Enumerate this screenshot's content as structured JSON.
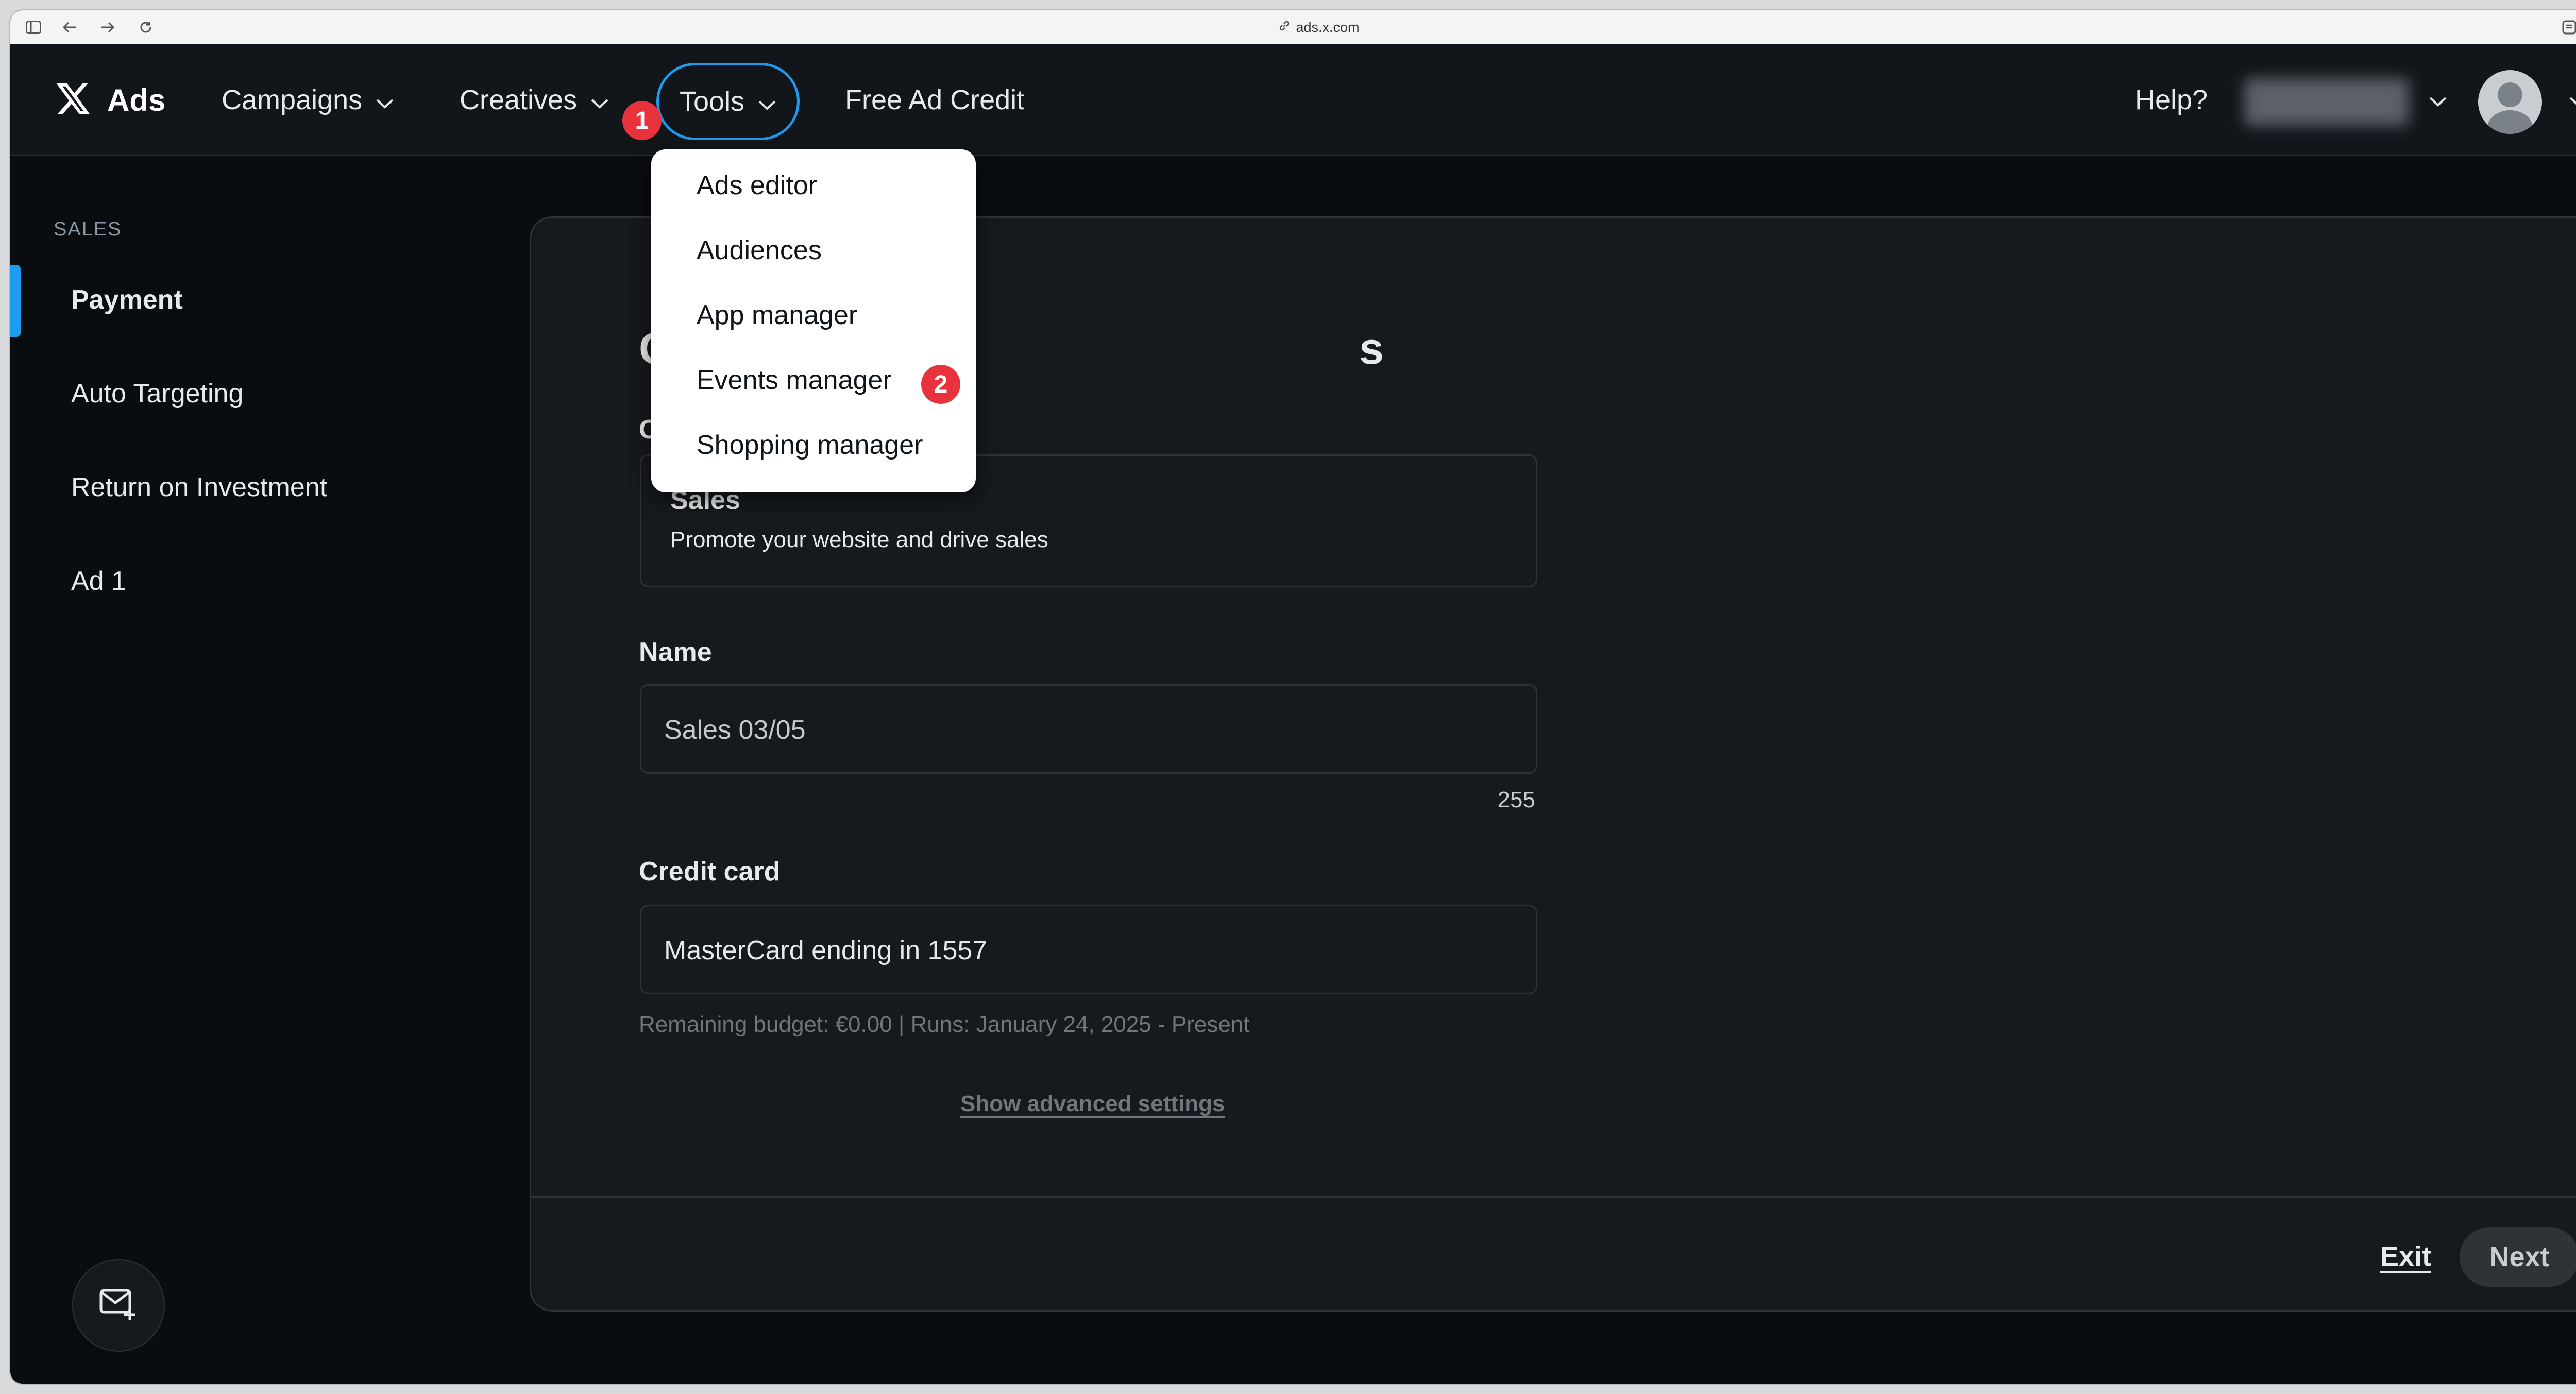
{
  "browser": {
    "url": "ads.x.com"
  },
  "nav": {
    "brand": "Ads",
    "items": [
      {
        "label": "Campaigns"
      },
      {
        "label": "Creatives"
      },
      {
        "label": "Tools"
      },
      {
        "label": "Free Ad Credit"
      }
    ],
    "help": "Help?"
  },
  "dropdown": {
    "items": [
      {
        "label": "Ads editor"
      },
      {
        "label": "Audiences"
      },
      {
        "label": "App manager"
      },
      {
        "label": "Events manager"
      },
      {
        "label": "Shopping manager"
      }
    ]
  },
  "badges": {
    "one": "1",
    "two": "2"
  },
  "sidebar": {
    "heading": "SALES",
    "items": [
      {
        "label": "Payment"
      },
      {
        "label": "Auto Targeting"
      },
      {
        "label": "Return on Investment"
      },
      {
        "label": "Ad 1"
      }
    ]
  },
  "form": {
    "title_partial_left": "C",
    "title_partial_right": "s",
    "objective_label_partial": "C",
    "objective": {
      "title": "Sales",
      "subtitle": "Promote your website and drive sales"
    },
    "name_label": "Name",
    "name_value": "Sales 03/05",
    "name_counter": "255",
    "credit_label": "Credit card",
    "credit_value": "MasterCard ending in 1557",
    "credit_note": "Remaining budget: €0.00 | Runs: January 24, 2025 - Present",
    "advanced": "Show advanced settings"
  },
  "footer": {
    "exit": "Exit",
    "next": "Next"
  },
  "colors": {
    "accent": "#1d9bf0",
    "badge": "#e8323c",
    "background": "#0a0d10",
    "card": "#16191d"
  }
}
